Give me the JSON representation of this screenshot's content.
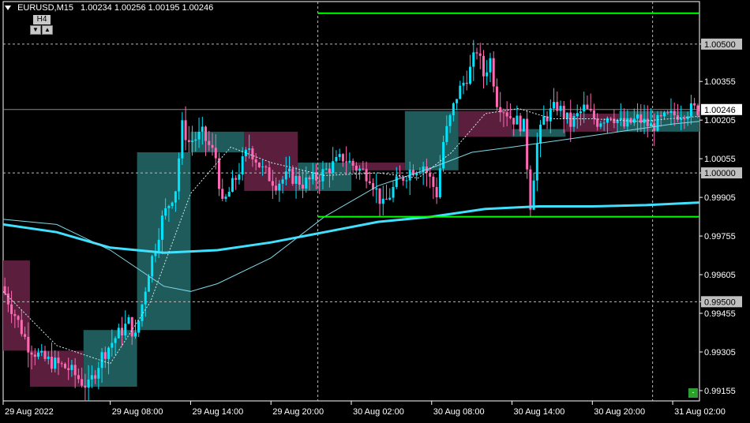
{
  "header": {
    "symbol": "EURUSD,M15",
    "ohlc": "1.00234 1.00256 1.00195 1.00246"
  },
  "timeframe_box": {
    "label": "H4",
    "down_glyph": "▼",
    "up_glyph": "▲"
  },
  "colors": {
    "background": "#000000",
    "bull_candle": "#00e5ff",
    "bear_candle": "#ff69b4",
    "htf_bull_box": "#1f5b5b",
    "htf_bear_box": "#5b1f3d",
    "level_line": "#00ff00",
    "ma_slow": "#40e0ff",
    "ma_fast": "#7fd8e6"
  },
  "current_price_label": "1.00246",
  "horizontal_level_labels": [
    "1.00500",
    "1.00000",
    "0.99500"
  ],
  "green_button_glyph": "-",
  "chart_data": {
    "type": "candlestick",
    "symbol": "EURUSD",
    "timeframe": "M15",
    "ylim": [
      0.99115,
      1.00665
    ],
    "y_ticks": [
      "1.00500",
      "1.00355",
      "1.00205",
      "1.00055",
      "1.00000",
      "0.99905",
      "0.99755",
      "0.99605",
      "0.99500",
      "0.99455",
      "0.99305",
      "0.99155"
    ],
    "y_tick_values": [
      1.005,
      1.00355,
      1.00205,
      1.00055,
      1.0,
      0.99905,
      0.99755,
      0.99605,
      0.995,
      0.99455,
      0.99305,
      0.99155
    ],
    "x_ticks": [
      "29 Aug 2022",
      "29 Aug 08:00",
      "29 Aug 14:00",
      "29 Aug 20:00",
      "30 Aug 02:00",
      "30 Aug 08:00",
      "30 Aug 14:00",
      "30 Aug 20:00",
      "31 Aug 02:00"
    ],
    "x_tick_bar_index": [
      0,
      32,
      56,
      80,
      104,
      128,
      152,
      176,
      200
    ],
    "current_price": 1.00246,
    "level_lines": [
      1.0062,
      0.9983
    ],
    "level_line_bar_range": [
      94,
      208
    ],
    "dashed_horizontal_levels": [
      1.005,
      1.0,
      0.995
    ],
    "dashed_vertical_bar_index": [
      94,
      194
    ],
    "htf_boxes": [
      {
        "dir": "bear",
        "start": 0,
        "end": 8,
        "open": 0.9966,
        "close": 0.9931
      },
      {
        "dir": "bear",
        "start": 8,
        "end": 24,
        "open": 0.9931,
        "close": 0.9917
      },
      {
        "dir": "bull",
        "start": 24,
        "end": 40,
        "open": 0.9917,
        "close": 0.9939
      },
      {
        "dir": "bull",
        "start": 40,
        "end": 56,
        "open": 0.9939,
        "close": 1.0008
      },
      {
        "dir": "bull",
        "start": 56,
        "end": 72,
        "open": 1.0008,
        "close": 1.0016
      },
      {
        "dir": "bear",
        "start": 72,
        "end": 88,
        "open": 1.0016,
        "close": 0.9993
      },
      {
        "dir": "bull",
        "start": 88,
        "end": 104,
        "open": 0.9993,
        "close": 1.0004
      },
      {
        "dir": "bear",
        "start": 104,
        "end": 120,
        "open": 1.0004,
        "close": 1.0001
      },
      {
        "dir": "bull",
        "start": 120,
        "end": 136,
        "open": 1.0001,
        "close": 1.0024
      },
      {
        "dir": "bear",
        "start": 136,
        "end": 152,
        "open": 1.0024,
        "close": 1.0014
      },
      {
        "dir": "bull",
        "start": 152,
        "end": 168,
        "open": 1.0014,
        "close": 1.0017
      },
      {
        "dir": "bear",
        "start": 168,
        "end": 184,
        "open": 1.0023,
        "close": 1.0016
      },
      {
        "dir": "bull",
        "start": 184,
        "end": 208,
        "open": 1.0016,
        "close": 1.0024
      }
    ],
    "close_path": [
      [
        0,
        0.9956
      ],
      [
        4,
        0.9945
      ],
      [
        8,
        0.9933
      ],
      [
        12,
        0.9928
      ],
      [
        16,
        0.9926
      ],
      [
        20,
        0.9924
      ],
      [
        24,
        0.9919
      ],
      [
        26,
        0.9917
      ],
      [
        30,
        0.9929
      ],
      [
        34,
        0.9936
      ],
      [
        38,
        0.9942
      ],
      [
        40,
        0.9936
      ],
      [
        44,
        0.9962
      ],
      [
        48,
        0.9982
      ],
      [
        52,
        0.9994
      ],
      [
        54,
        1.0018
      ],
      [
        56,
        1.0012
      ],
      [
        60,
        1.0015
      ],
      [
        64,
        1.0006
      ],
      [
        66,
        0.9987
      ],
      [
        70,
        0.9998
      ],
      [
        74,
        1.001
      ],
      [
        78,
        1.0001
      ],
      [
        82,
        0.9996
      ],
      [
        86,
        0.9999
      ],
      [
        90,
        0.9996
      ],
      [
        94,
        0.9998
      ],
      [
        98,
        1.0002
      ],
      [
        102,
        1.0006
      ],
      [
        106,
        1.0002
      ],
      [
        110,
        0.9999
      ],
      [
        114,
        0.9987
      ],
      [
        118,
        0.9996
      ],
      [
        122,
        1.0001
      ],
      [
        126,
        1.0003
      ],
      [
        130,
        0.9992
      ],
      [
        132,
        1.0012
      ],
      [
        136,
        1.003
      ],
      [
        140,
        1.004
      ],
      [
        142,
        1.0048
      ],
      [
        144,
        1.0038
      ],
      [
        146,
        1.0044
      ],
      [
        148,
        1.0028
      ],
      [
        152,
        1.0022
      ],
      [
        156,
        1.0018
      ],
      [
        158,
        0.9988
      ],
      [
        160,
        1.0011
      ],
      [
        162,
        1.0021
      ],
      [
        166,
        1.0026
      ],
      [
        170,
        1.0019
      ],
      [
        174,
        1.0025
      ],
      [
        178,
        1.002
      ],
      [
        182,
        1.0023
      ],
      [
        186,
        1.0018
      ],
      [
        190,
        1.0021
      ],
      [
        194,
        1.0018
      ],
      [
        198,
        1.0021
      ],
      [
        202,
        1.0023
      ],
      [
        206,
        1.00246
      ]
    ],
    "ma_slow": [
      [
        0,
        0.998
      ],
      [
        16,
        0.9977
      ],
      [
        32,
        0.9971
      ],
      [
        48,
        0.9969
      ],
      [
        64,
        0.997
      ],
      [
        80,
        0.9973
      ],
      [
        96,
        0.9977
      ],
      [
        112,
        0.9981
      ],
      [
        128,
        0.9983
      ],
      [
        144,
        0.9986
      ],
      [
        160,
        0.9987
      ],
      [
        176,
        0.9987
      ],
      [
        192,
        0.99875
      ],
      [
        208,
        0.99885
      ]
    ],
    "ma_fast": [
      [
        0,
        0.9982
      ],
      [
        16,
        0.998
      ],
      [
        32,
        0.997
      ],
      [
        48,
        0.9956
      ],
      [
        56,
        0.9954
      ],
      [
        64,
        0.9957
      ],
      [
        80,
        0.9967
      ],
      [
        96,
        0.9983
      ],
      [
        112,
        0.9995
      ],
      [
        128,
        1.0002
      ],
      [
        140,
        1.0008
      ],
      [
        152,
        1.001
      ],
      [
        168,
        1.0013
      ],
      [
        184,
        1.0016
      ],
      [
        200,
        1.0019
      ],
      [
        208,
        1.002
      ]
    ],
    "ma_dashed": [
      [
        0,
        0.9954
      ],
      [
        16,
        0.9933
      ],
      [
        32,
        0.9926
      ],
      [
        44,
        0.995
      ],
      [
        56,
        0.9992
      ],
      [
        68,
        1.001
      ],
      [
        80,
        1.0004
      ],
      [
        96,
        0.9999
      ],
      [
        112,
        1.0
      ],
      [
        124,
        0.9998
      ],
      [
        134,
        1.0008
      ],
      [
        144,
        1.0023
      ],
      [
        154,
        1.0025
      ],
      [
        164,
        1.0021
      ],
      [
        176,
        1.0021
      ],
      [
        190,
        1.002
      ],
      [
        208,
        1.0022
      ]
    ]
  }
}
